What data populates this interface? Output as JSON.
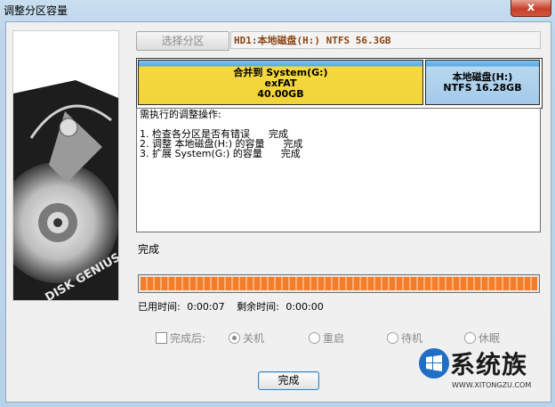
{
  "window": {
    "title": "调整分区容量",
    "close_label": "x"
  },
  "toolbar": {
    "select_label": "选择分区",
    "disk_info": "HD1:本地磁盘(H:) NTFS 56.3GB"
  },
  "partitions": [
    {
      "line1": "合并到 System(G:)",
      "line2": "exFAT",
      "line3": "40.00GB"
    },
    {
      "line1": "本地磁盘(H:)",
      "line2": "NTFS 16.28GB"
    }
  ],
  "log": {
    "header": "需执行的调整操作:",
    "lines": [
      "1. 检查各分区是否有错误      完成",
      "2. 调整 本地磁盘(H:) 的容量      完成",
      "3. 扩展 System(G:) 的容量      完成"
    ]
  },
  "status": "完成",
  "progress": {
    "percent": 100
  },
  "times": {
    "elapsed_label": "已用时间:",
    "elapsed": "0:00:07",
    "remaining_label": "剩余时间:",
    "remaining": "0:00:00"
  },
  "options": {
    "after_label": "完成后:",
    "shutdown": "关机",
    "restart": "重启",
    "standby": "待机",
    "hibernate": "休眠"
  },
  "buttons": {
    "done": "完成"
  },
  "watermark": {
    "brand": "系统族",
    "url": "WWW.XITONGZU.COM"
  },
  "side_image": {
    "text": "DISK GENIUS"
  }
}
